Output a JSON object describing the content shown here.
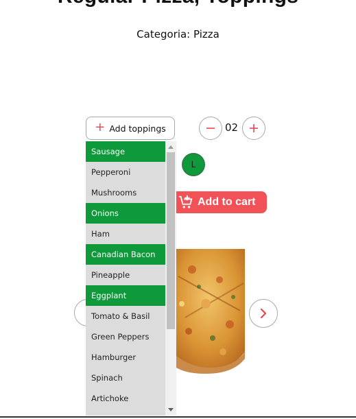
{
  "product": {
    "title": "Regular Pizza, Toppings",
    "category": "Categoria: Pizza"
  },
  "toppings": {
    "button_label": "Add toppings",
    "items": [
      {
        "label": "Sausage",
        "selected": true
      },
      {
        "label": "Pepperoni",
        "selected": false
      },
      {
        "label": "Mushrooms",
        "selected": false
      },
      {
        "label": "Onions",
        "selected": true
      },
      {
        "label": "Ham",
        "selected": false
      },
      {
        "label": "Canadian Bacon",
        "selected": true
      },
      {
        "label": "Pineapple",
        "selected": false
      },
      {
        "label": "Eggplant",
        "selected": true
      },
      {
        "label": "Tomato & Basil",
        "selected": false
      },
      {
        "label": "Green Peppers",
        "selected": false
      },
      {
        "label": "Hamburger",
        "selected": false
      },
      {
        "label": "Spinach",
        "selected": false
      },
      {
        "label": "Artichoke",
        "selected": false
      }
    ]
  },
  "quantity": {
    "value": "02",
    "decrement_icon": "minus-icon",
    "increment_icon": "plus-icon"
  },
  "size": {
    "selected": "L"
  },
  "cart": {
    "button_label": "Add to cart",
    "icon": "cart-add-icon"
  },
  "colors": {
    "accent": "#f25257",
    "selected_green": "#0e9a3b"
  }
}
